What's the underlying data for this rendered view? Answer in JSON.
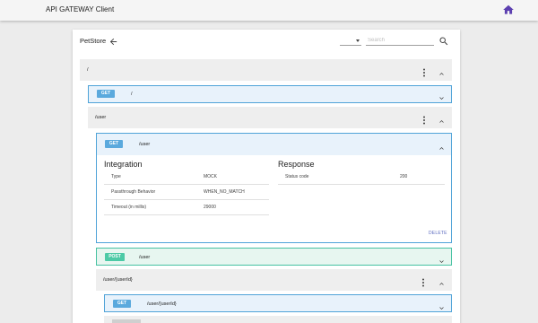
{
  "app": {
    "title": "API GATEWAY Client",
    "home_icon": "home-icon",
    "accent_color": "#5c3fb0"
  },
  "card": {
    "title": "PetStore",
    "back_icon": "arrow-left-icon",
    "method_filter": {
      "selected": ""
    },
    "search": {
      "placeholder": "Search",
      "value": ""
    },
    "search_icon": "search-icon"
  },
  "resources": [
    {
      "path": "/"
    },
    {
      "path": "/user"
    },
    {
      "path": "/user/{userId}"
    }
  ],
  "methods": {
    "root_get": {
      "method": "GET",
      "path": "/"
    },
    "user_get": {
      "method": "GET",
      "path": "/user"
    },
    "user_post": {
      "method": "POST",
      "path": "/user"
    },
    "userid_get": {
      "method": "GET",
      "path": "/user/{userId}"
    }
  },
  "integration": {
    "title": "Integration",
    "rows": [
      {
        "key": "Type",
        "value": "MOCK"
      },
      {
        "key": "Passthrough Behavior",
        "value": "WHEN_NO_MATCH"
      },
      {
        "key": "Timeout (in millis)",
        "value": "29000"
      }
    ]
  },
  "response": {
    "title": "Response",
    "rows": [
      {
        "key": "Status code",
        "value": "200"
      }
    ]
  },
  "actions": {
    "delete_label": "DELETE"
  },
  "colors": {
    "get_badge": "#5aa9dd",
    "post_badge": "#4ccaa6",
    "get_panel_border": "#4fa3d8",
    "post_panel_border": "#46c1a2"
  }
}
